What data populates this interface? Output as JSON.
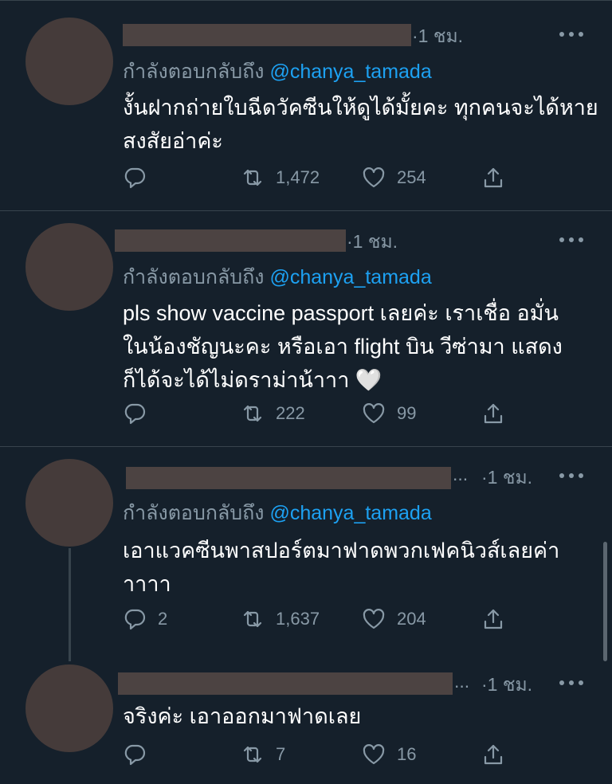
{
  "tweets": [
    {
      "time": "·1 ชม.",
      "replying_prefix": "กำลังตอบกลับถึง",
      "replying_handle": "@chanya_tamada",
      "text": "งั้นฝากถ่ายใบฉีดวัคซีนให้ดูได้มั้ยคะ ทุกคนจะได้หายสงสัยอ่าค่ะ",
      "reply_count": "",
      "retweet_count": "1,472",
      "like_count": "254"
    },
    {
      "time": "·1 ชม.",
      "replying_prefix": "กำลังตอบกลับถึง",
      "replying_handle": "@chanya_tamada",
      "text": "pls show vaccine passport เลยค่ะ เราเชื่อ อมั่นในน้องชัญนะคะ หรือเอา flight บิน วีซ่ามา แสดงก็ได้จะได้ไม่ดราม่าน้าาา 🤍",
      "reply_count": "",
      "retweet_count": "222",
      "like_count": "99"
    },
    {
      "ellipsis": "...",
      "time": "·1 ชม.",
      "replying_prefix": "กำลังตอบกลับถึง",
      "replying_handle": "@chanya_tamada",
      "text": "เอาแวคซีนพาสปอร์ตมาฟาดพวกเฟคนิวส์เลยค่าาาาา",
      "reply_count": "2",
      "retweet_count": "1,637",
      "like_count": "204"
    },
    {
      "ellipsis": "...",
      "time": "·1 ชม.",
      "text": "จริงค่ะ เอาออกมาฟาดเลย",
      "reply_count": "",
      "retweet_count": "7",
      "like_count": "16"
    }
  ],
  "icons": {
    "reply": "reply-icon",
    "retweet": "retweet-icon",
    "like": "like-icon",
    "share": "share-icon",
    "more": "more-icon"
  },
  "colors": {
    "background": "#15202b",
    "muted": "#8899a6",
    "link": "#1da1f2",
    "divider": "#38444d"
  }
}
